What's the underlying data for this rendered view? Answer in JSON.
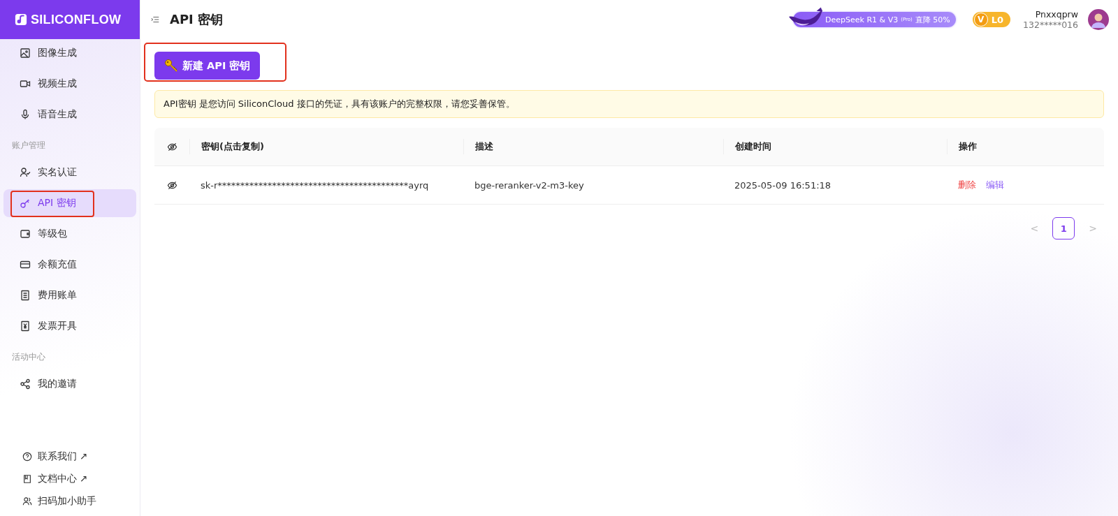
{
  "brand": {
    "name": "SILICONFLOW"
  },
  "header": {
    "title": "API 密钥",
    "promo": {
      "text": "DeepSeek R1 & V3",
      "tag": "(Pro)",
      "discount": "直降 50%"
    },
    "level_badge": {
      "mark": "V",
      "text": "L0"
    },
    "user": {
      "name": "Pnxxqprw",
      "phone": "132*****016"
    }
  },
  "sidebar": {
    "groups": [
      {
        "items": [
          {
            "label": "图像生成",
            "kind": "image",
            "selected": false,
            "highlighted": false
          },
          {
            "label": "视频生成",
            "kind": "video",
            "selected": false,
            "highlighted": false
          },
          {
            "label": "语音生成",
            "kind": "mic",
            "selected": false,
            "highlighted": false
          }
        ]
      },
      {
        "title": "账户管理",
        "items": [
          {
            "label": "实名认证",
            "kind": "user",
            "selected": false,
            "highlighted": false
          },
          {
            "label": "API 密钥",
            "kind": "key",
            "selected": true,
            "highlighted": true
          },
          {
            "label": "等级包",
            "kind": "wallet",
            "selected": false,
            "highlighted": false
          },
          {
            "label": "余额充值",
            "kind": "card",
            "selected": false,
            "highlighted": false
          },
          {
            "label": "费用账单",
            "kind": "bill",
            "selected": false,
            "highlighted": false
          },
          {
            "label": "发票开具",
            "kind": "invoice",
            "selected": false,
            "highlighted": false
          }
        ]
      },
      {
        "title": "活动中心",
        "items": [
          {
            "label": "我的邀请",
            "kind": "share",
            "selected": false,
            "highlighted": false
          }
        ]
      }
    ],
    "footer": [
      {
        "label": "联系我们 ↗",
        "kind": "help"
      },
      {
        "label": "文档中心 ↗",
        "kind": "book"
      },
      {
        "label": "扫码加小助手",
        "kind": "users"
      }
    ]
  },
  "new_key_button": {
    "label": "新建 API 密钥",
    "highlighted": true
  },
  "notice": "API密钥 是您访问 SiliconCloud 接口的凭证，具有该账户的完整权限，请您妥善保管。",
  "table": {
    "columns": [
      "密钥(点击复制)",
      "描述",
      "创建时间",
      "操作"
    ],
    "rows": [
      {
        "key": "sk-r******************************************ayrq",
        "description": "bge-reranker-v2-m3-key",
        "created": "2025-05-09 16:51:18",
        "actions": [
          {
            "label": "删除",
            "kind": "danger"
          },
          {
            "label": "编辑",
            "kind": "primary"
          }
        ]
      }
    ]
  },
  "pagination": {
    "prev": "<",
    "next": ">",
    "pages": [
      {
        "label": "1",
        "selected": true
      }
    ]
  }
}
